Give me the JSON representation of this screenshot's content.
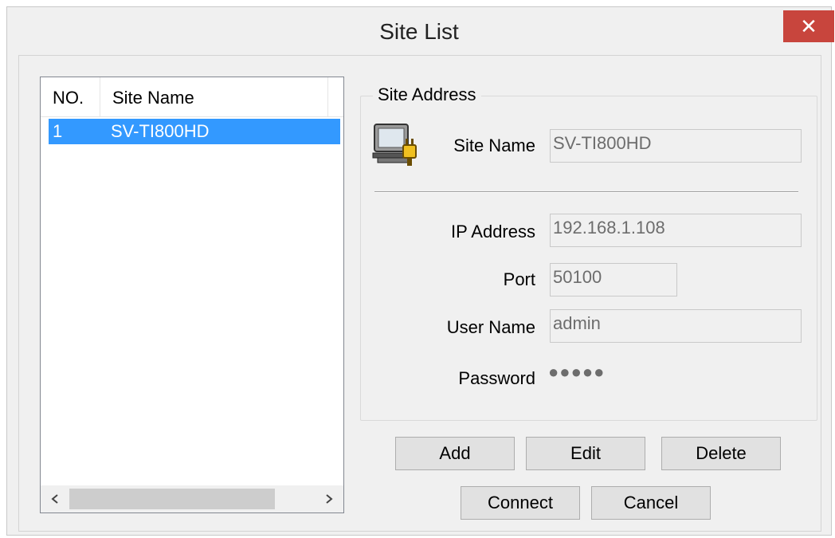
{
  "window": {
    "title": "Site List",
    "close_label": "✕"
  },
  "site_list": {
    "columns": [
      "NO.",
      "Site Name"
    ],
    "rows": [
      {
        "no": "1",
        "name": "SV-TI800HD"
      }
    ],
    "scroll_left": "<",
    "scroll_right": ">"
  },
  "site_address": {
    "group_title": "Site Address",
    "site_name_label": "Site Name",
    "site_name_value": "SV-TI800HD",
    "ip_label": "IP Address",
    "ip_value": "192.168.1.108",
    "port_label": "Port",
    "port_value": "50100",
    "user_label": "User Name",
    "user_value": "admin",
    "password_label": "Password",
    "password_value": "●●●●●"
  },
  "buttons": {
    "add": "Add",
    "edit": "Edit",
    "delete": "Delete",
    "connect": "Connect",
    "cancel": "Cancel"
  },
  "icons": {
    "site": "computer-plug-icon",
    "close": "close-icon"
  },
  "colors": {
    "selection": "#3399ff",
    "close_button": "#c8453d"
  }
}
